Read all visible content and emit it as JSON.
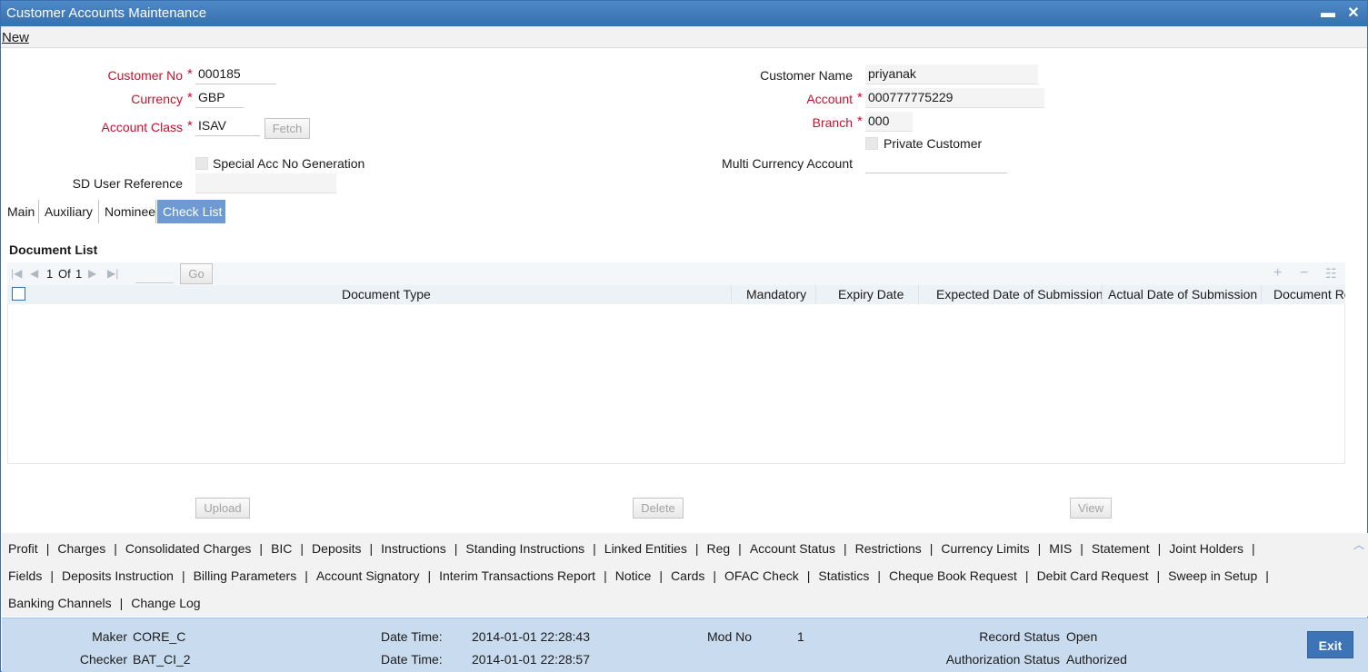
{
  "window": {
    "title": "Customer Accounts Maintenance",
    "minimize_glyph": "▬",
    "close_glyph": "✕"
  },
  "menu": {
    "new_label": "New"
  },
  "form": {
    "customer_no_label": "Customer No",
    "customer_no_value": "000185",
    "currency_label": "Currency",
    "currency_value": "GBP",
    "account_class_label": "Account Class",
    "account_class_value": "ISAV",
    "fetch_label": "Fetch",
    "special_acc_label": "Special Acc No Generation",
    "sd_user_ref_label": "SD User Reference",
    "sd_user_ref_value": "",
    "customer_name_label": "Customer Name",
    "customer_name_value": "priyanak",
    "account_label": "Account",
    "account_value": "000777775229",
    "branch_label": "Branch",
    "branch_value": "000",
    "private_customer_label": "Private Customer",
    "multi_currency_label": "Multi Currency Account",
    "multi_currency_value": "",
    "required_marker": "*"
  },
  "tabs": [
    {
      "label": "Main",
      "active": false
    },
    {
      "label": "Auxiliary",
      "active": false
    },
    {
      "label": "Nominee",
      "active": false
    },
    {
      "label": "Check List",
      "active": true
    }
  ],
  "document_list": {
    "title": "Document List",
    "page_current": "1",
    "page_of": "Of",
    "page_total": "1",
    "go_label": "Go",
    "columns": [
      "Document Type",
      "Mandatory",
      "Expiry Date",
      "Expected Date of Submission",
      "Actual Date of Submission",
      "Document Re"
    ],
    "rows": []
  },
  "actions": {
    "upload_label": "Upload",
    "delete_label": "Delete",
    "view_label": "View"
  },
  "bottom_links": {
    "row1": [
      "Profit",
      "Charges",
      "Consolidated Charges",
      "BIC",
      "Deposits",
      "Instructions",
      "Standing Instructions",
      "Linked Entities",
      "Reg",
      "Account Status",
      "Restrictions",
      "Currency Limits",
      "MIS",
      "Statement",
      "Joint Holders"
    ],
    "row2": [
      "Fields",
      "Deposits Instruction",
      "Billing Parameters",
      "Account Signatory",
      "Interim Transactions Report",
      "Notice",
      "Cards",
      "OFAC Check",
      "Statistics",
      "Cheque Book Request",
      "Debit Card Request",
      "Sweep in Setup"
    ],
    "row3": [
      "Banking Channels",
      "Change Log"
    ]
  },
  "footer": {
    "maker_label": "Maker",
    "maker_value": "CORE_C",
    "checker_label": "Checker",
    "checker_value": "BAT_CI_2",
    "date_time_label": "Date Time:",
    "maker_date_time": "2014-01-01 22:28:43",
    "checker_date_time": "2014-01-01 22:28:57",
    "mod_no_label": "Mod No",
    "mod_no_value": "1",
    "record_status_label": "Record Status",
    "record_status_value": "Open",
    "auth_status_label": "Authorization Status",
    "auth_status_value": "Authorized",
    "exit_label": "Exit"
  },
  "colors": {
    "title_bar": "#3f7abb",
    "required_red": "#c8102e",
    "active_tab": "#6d9ad1",
    "footer_bg": "#c9dcef",
    "exit_button": "#3d74b6"
  }
}
